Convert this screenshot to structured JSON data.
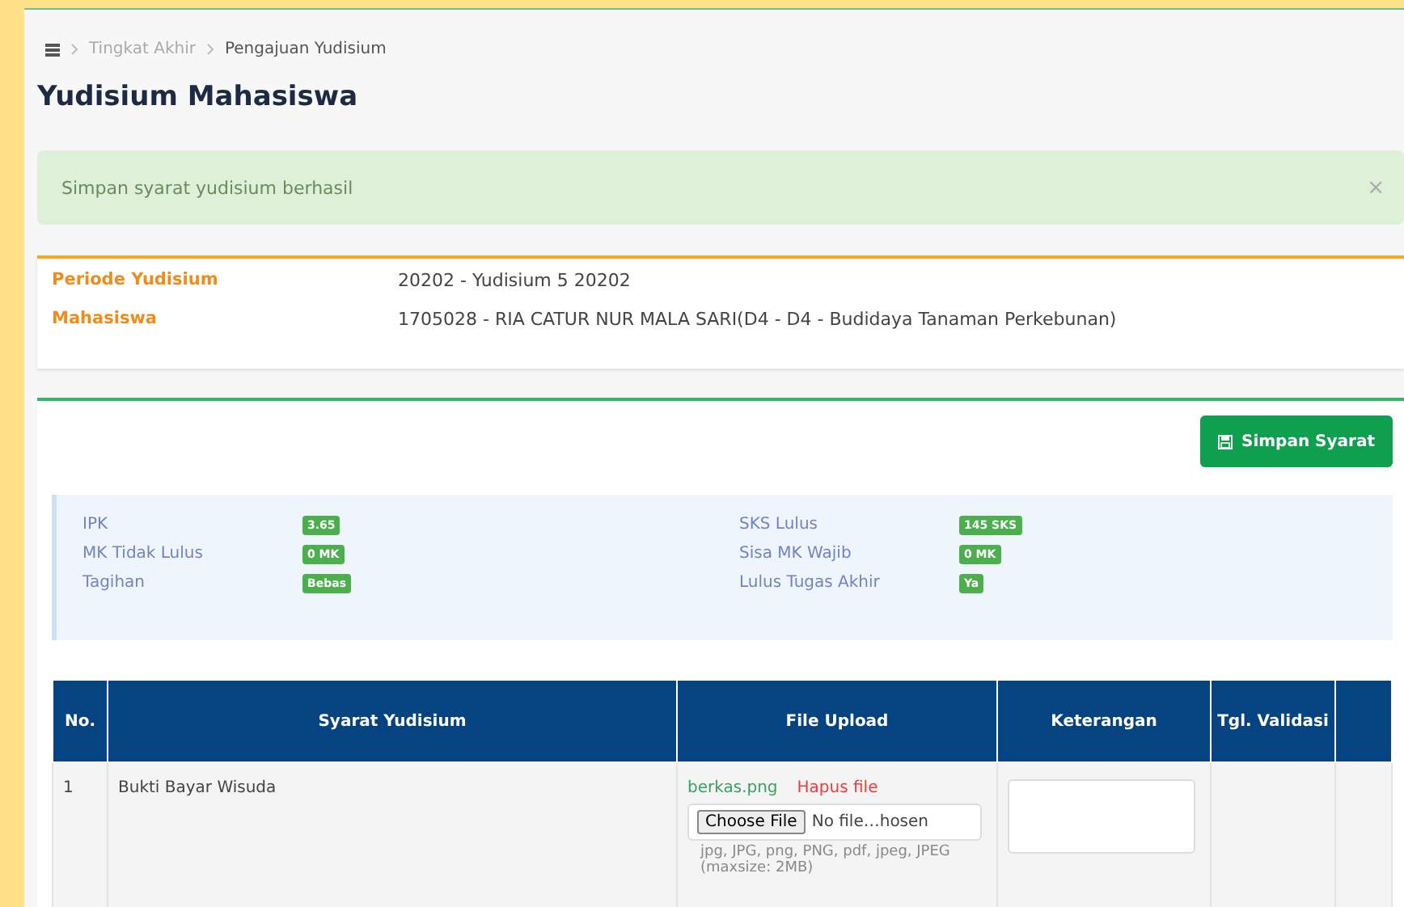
{
  "breadcrumb": {
    "items": [
      {
        "label": "Tingkat Akhir",
        "current": false
      },
      {
        "label": "Pengajuan Yudisium",
        "current": true
      }
    ]
  },
  "page_title": "Yudisium Mahasiswa",
  "alert": {
    "message": "Simpan syarat yudisium berhasil",
    "close": "×"
  },
  "info": [
    {
      "label": "Periode Yudisium",
      "value": "20202 - Yudisium 5 20202"
    },
    {
      "label": "Mahasiswa",
      "value": "1705028 - RIA CATUR NUR MALA SARI(D4 - D4 - Budidaya Tanaman Perkebunan)"
    }
  ],
  "save_button": "Simpan Syarat",
  "stats": [
    {
      "label": "IPK",
      "value": "3.65"
    },
    {
      "label": "SKS Lulus",
      "value": "145 SKS"
    },
    {
      "label": "MK Tidak Lulus",
      "value": "0 MK"
    },
    {
      "label": "Sisa MK Wajib",
      "value": "0 MK"
    },
    {
      "label": "Tagihan",
      "value": "Bebas"
    },
    {
      "label": "Lulus Tugas Akhir",
      "value": "Ya"
    }
  ],
  "table": {
    "columns": [
      "No.",
      "Syarat Yudisium",
      "File Upload",
      "Keterangan",
      "Tgl. Validasi"
    ],
    "rows": [
      {
        "no": "1",
        "syarat": "Bukti Bayar Wisuda",
        "file_name": "berkas.png",
        "delete": "Hapus file",
        "choose": "Choose File",
        "file_status": "No file…hosen",
        "hint": "jpg, JPG, png, PNG, pdf, jpeg, JPEG (maxsize: 2MB)"
      }
    ]
  }
}
